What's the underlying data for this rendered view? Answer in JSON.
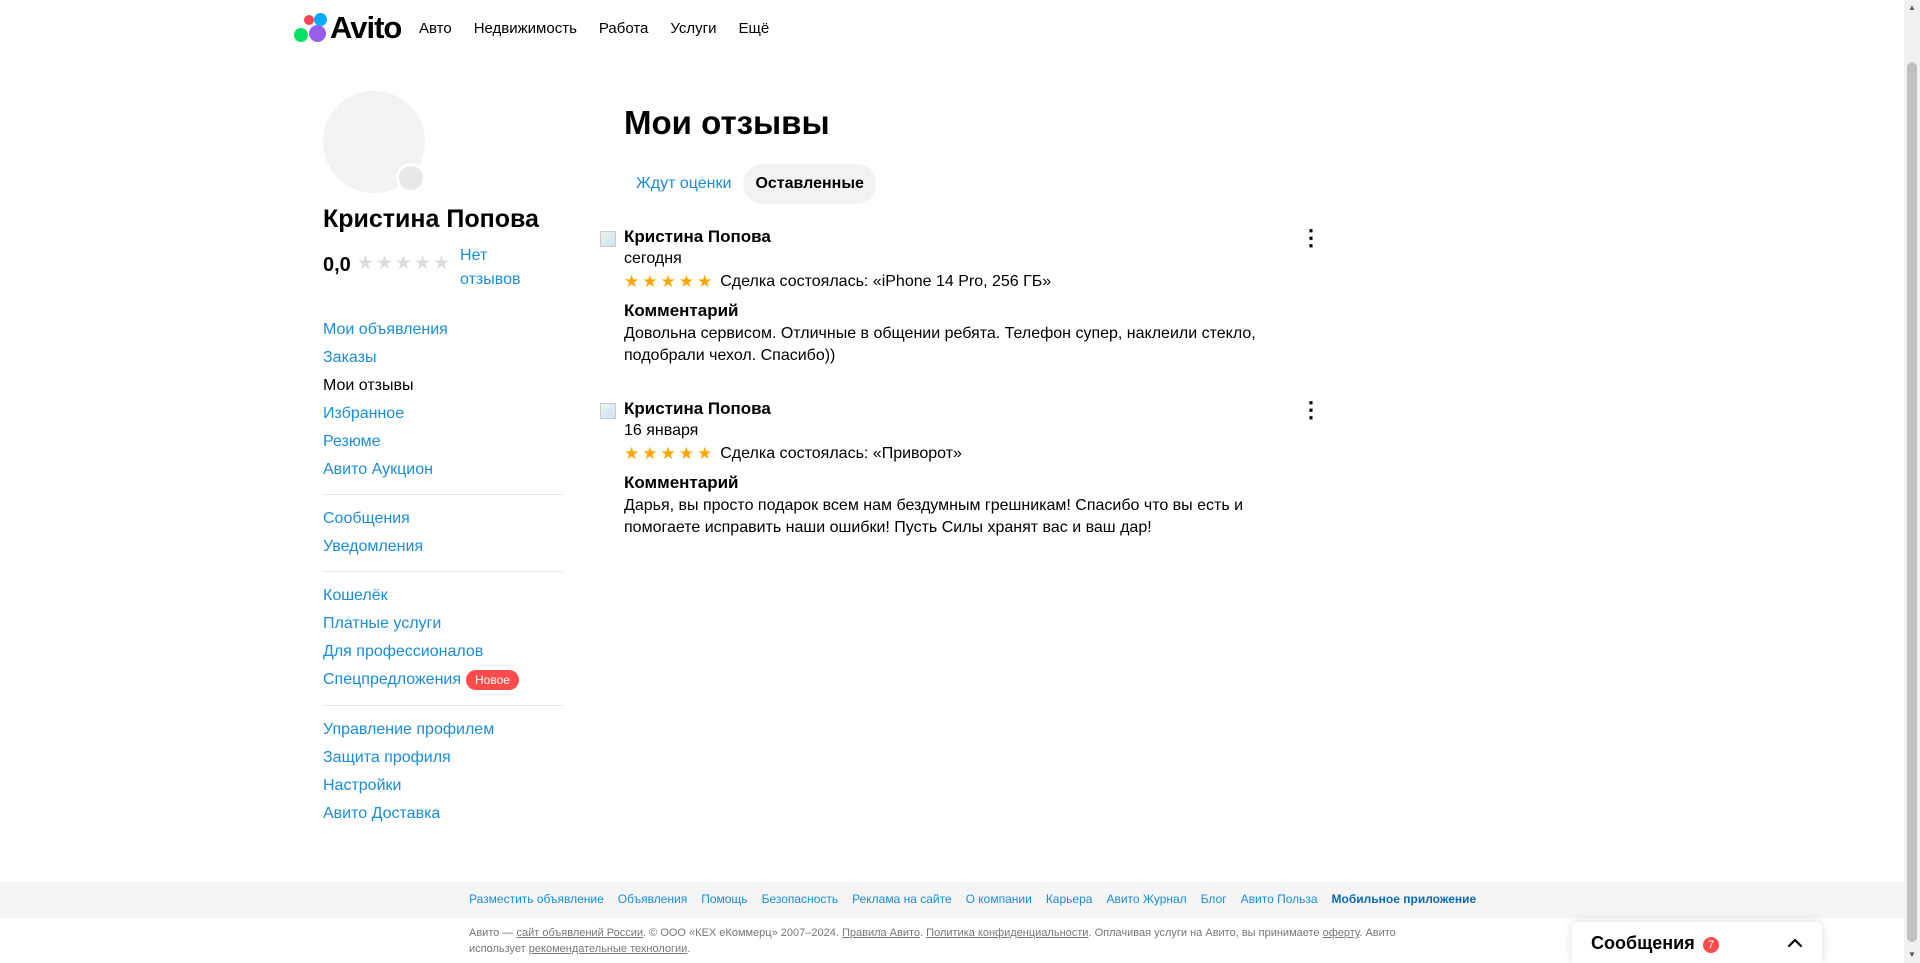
{
  "header": {
    "logo_text": "Avito",
    "nav": [
      "Авто",
      "Недвижимость",
      "Работа",
      "Услуги",
      "Ещё"
    ]
  },
  "profile": {
    "name": "Кристина Попова",
    "rating": "0,0",
    "rating_stars": 0,
    "no_reviews": "Нет отзывов"
  },
  "sidebar": {
    "group1": [
      "Мои объявления",
      "Заказы",
      "Мои отзывы",
      "Избранное",
      "Резюме",
      "Авито Аукцион"
    ],
    "active_item": "Мои отзывы",
    "group2": [
      "Сообщения",
      "Уведомления"
    ],
    "group3": [
      "Кошелёк",
      "Платные услуги",
      "Для профессионалов",
      "Спецпредложения"
    ],
    "new_badge": "Новое",
    "group4": [
      "Управление профилем",
      "Защита профиля",
      "Настройки",
      "Авито Доставка"
    ]
  },
  "main": {
    "title": "Мои отзывы",
    "tabs": [
      "Ждут оценки",
      "Оставленные"
    ],
    "selected_tab": "Оставленные"
  },
  "reviews": [
    {
      "author": "Кристина Попова",
      "date": "сегодня",
      "stars": 5,
      "deal": "Сделка состоялась: «iPhone 14 Pro, 256 ГБ»",
      "comment_title": "Комментарий",
      "comment": "Довольна сервисом. Отличные в общении ребята. Телефон супер, наклеили стекло, подобрали чехол. Спасибо))"
    },
    {
      "author": "Кристина Попова",
      "date": "16 января",
      "stars": 5,
      "deal": "Сделка состоялась: «Приворот»",
      "comment_title": "Комментарий",
      "comment": "Дарья, вы просто подарок всем нам бездумным грешникам! Спасибо что вы есть и помогаете исправить наши ошибки! Пусть Силы хранят вас и ваш дар!"
    }
  ],
  "footer": {
    "links": [
      "Разместить объявление",
      "Объявления",
      "Помощь",
      "Безопасность",
      "Реклама на сайте",
      "О компании",
      "Карьера",
      "Авито Журнал",
      "Блог",
      "Авито Польза"
    ],
    "app_link": "Мобильное приложение",
    "legal": {
      "p1": "Авито — ",
      "l1": "сайт объявлений России",
      "p2": ". © ООО «КЕХ еКоммерц» 2007–2024. ",
      "l2": "Правила Авито",
      "p3": ". ",
      "l3": "Политика конфиденциальности",
      "p4": ". Оплачивая услуги на Авито, вы принимаете ",
      "l4": "оферту",
      "p5": ". Авито использует ",
      "l5": "рекомендательные технологии",
      "p6": "."
    }
  },
  "messages_widget": {
    "title": "Сообщения",
    "count": "7"
  },
  "colors": {
    "link": "#1a8cd8",
    "star": "#ffa500",
    "badge": "#ff4b4b"
  }
}
